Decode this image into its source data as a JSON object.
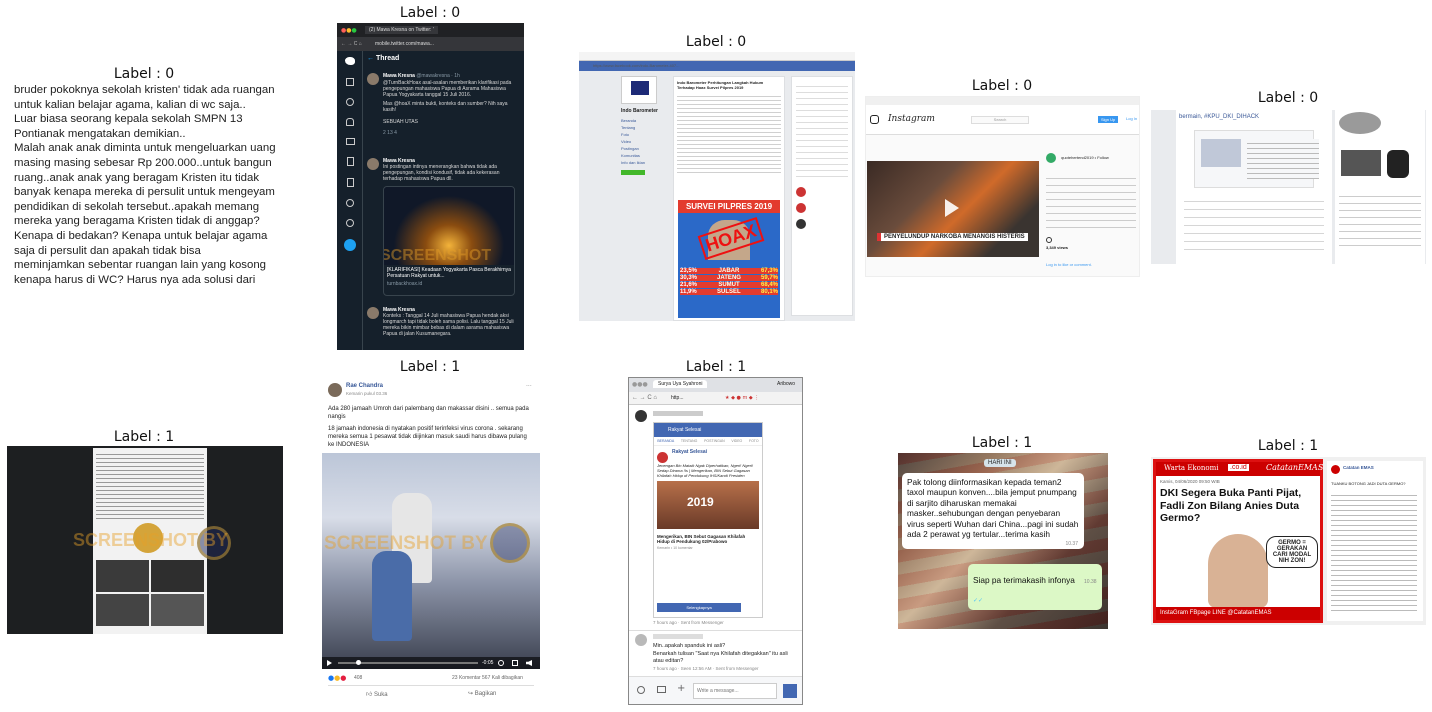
{
  "labels": [
    "Label : 0",
    "Label : 0",
    "Label : 0",
    "Label : 0",
    "Label : 0",
    "Label : 1",
    "Label : 1",
    "Label : 1",
    "Label : 1",
    "Label : 1"
  ],
  "text_post": {
    "lines": [
      "bruder pokoknya sekolah kristen'  tidak ada ruangan",
      "untuk kalian belajar agama, kalian di wc saja..",
      "Luar biasa seorang kepala sekolah SMPN 13",
      "Pontianak mengatakan demikian..",
      "Malah anak anak diminta untuk mengeluarkan uang",
      "masing masing sebesar Rp 200.000..untuk bangun",
      "ruang..anak anak yang beragam Kristen itu tidak",
      "banyak kenapa mereka di persulit untuk mengeyam",
      "pendidikan di sekolah tersebut..apakah memang",
      "mereka yang beragama Kristen tidak di anggap?",
      "Kenapa di bedakan? Kenapa untuk belajar agama",
      "saja di persulit dan apakah tidak bisa",
      "meminjamkan sebentar ruangan lain yang kosong",
      "kenapa harus di WC? Harus nya ada solusi dari"
    ]
  },
  "twitter": {
    "tab_title": "(2) Mawa Kresna on Twitter: '",
    "url": "mobile.twitter.com/mawa...",
    "header": "Thread",
    "user1": "Mawa Kresna",
    "handle1": "@mawakresna · 1h",
    "tweet1": "@TurnBackHoax asal-asalan memberikan klarifikasi pada pengepungan mahasiswa Papua di Asrama Mahasiswa Papua Yogyakarta tanggal 15 Juli 2016.",
    "tweet1b": "Mas @hoaX minta bukti, konteks dan sumber? Nih saya kasih!",
    "sebuah": "SEBUAH UTAS",
    "counts1": "2     13     4",
    "tweet2": "Ini postingan intinya menerangkan bahwa tidak ada pengepungan, kondisi kondusif, tidak ada kekerasan terhadap mahasiswa Papua dll.",
    "card_title": "[KLARIFIKASI] Keadaan Yogyakarta Pasca Berakhirnya Persatuan Rakyat untuk...",
    "card_url": "turnbackhoax.id",
    "tweet3": "Konteks : Tanggal 14 Juli mahasiswa Papua hendak aksi longmarch tapi tidak boleh sama polisi. Lalu tanggal 15 Juli mereka bikin mimbar bebas di dalam asrama mahasiswa Papua di jalan Kusumanegara.",
    "watermark": "SCREENSHOT"
  },
  "facebook1": {
    "url": "https://www.facebook.com/indo-Barometer-407...",
    "page_name": "Indo Barometer",
    "nav": [
      "Beranda",
      "Tentang",
      "Foto",
      "Video",
      "Postingan",
      "Komunitas",
      "Info dan Iklan"
    ],
    "post_text": "Indo Barometer Perhitungan Langkah Hukum Terhadap Hoax Survei Pilpres 2019",
    "banner": "SURVEI PILPRES 2019",
    "stamp": "HOAX",
    "left_pct": [
      "23,5%",
      "30,3%",
      "21,6%",
      "11,9%"
    ],
    "left_region": [
      "JABAR",
      "JATENG",
      "SUMUT",
      "SULSEL"
    ],
    "right_pct": [
      "67,3%",
      "59,7%",
      "68,4%",
      "80,1%"
    ]
  },
  "instagram": {
    "url": "www.instagram.com/p/...",
    "logo": "Instagram",
    "search": "Search",
    "signup": "Sign Up",
    "login": "Log In",
    "username": "quotehertend2019 • Follow",
    "caption": "PENYELUNDUP NARKOBA MENANGIS HISTERIS",
    "views": "3,349 views",
    "comment": "Log in to like or comment."
  },
  "dki_post": {
    "snippet": "bermain, #KPU_DKI_DIHACK",
    "handle": "@KPU_DKI_DIHACK"
  },
  "fb_dark": {
    "watermark": "SCREENSHOT BY"
  },
  "rae": {
    "name": "Rae Chandra",
    "time": "Kemarin pukul 03.36",
    "text1": "Ada 280 jamaah Umroh dari palembang dan makassar disini .. semua pada nangis",
    "text2": "18 jamaah indonesia di nyatakan positif terinfeksi virus corona . sekarang mereka semua 1 pesawat tidak diijinkan masuk saudi harus dibawa pulang ke INDONESIA",
    "watermark": "SCREENSHOT BY",
    "time_left": "-0:05",
    "reactions": "408",
    "comments": "23 Komentar  567 Kali dibagikan",
    "like": "Suka",
    "share": "Bagikan"
  },
  "messenger": {
    "tab": "Surya Uya Syahroni",
    "user": "Aribowo",
    "url": "http...",
    "page": "Rakyat Selesai",
    "tabs": [
      "BERANDA",
      "TENTANG",
      "POSTINGAN",
      "VIDEO",
      "FOTO"
    ],
    "post_title": "Jenengan Bin Mataik Ngak Diperhatikan, Ngeri! Ngeri! Sedap Dirama !Is | Mengerikan, BIN Sebut Gagasan Khilafah Hidup di Pendukung IHS/Kandi Presiden",
    "banner_year": "2019",
    "link_title": "Mengerikan, BIN Sebut Gagasan Khilafah Hidup di Pendukung 02/Prabowo",
    "link_meta": "Kemarin • 10 komentar",
    "btn": "Selengkapnya",
    "sent1": "7 hours ago · Sent from Messenger",
    "msg1": "Min..apakah spanduk ini asli?",
    "msg2": "Benarkah tulisan \"Saat nya Khilafah ditegakkan\" itu asli atau editan?",
    "sent2": "7 hours ago · Seen 12:56 AM · Sent from Messenger",
    "placeholder": "Write a message..."
  },
  "whatsapp": {
    "bubble1": "Pak tolong diinformasikan kepada teman2 taxol maupun konven....bila jemput pnumpang di sarjito diharuskan memakai masker..sehubungan dengan penyebaran virus seperti Wuhan dari China...pagi ini sudah ada 2 perawat yg tertular...terima kasih",
    "time1": "10.37",
    "bubble2": "Siap pa terimakasih infonya",
    "time2": "10.38",
    "hari_ini": "HARI INI"
  },
  "warta": {
    "site": "Warta Ekonomi",
    "domain": ".co.id",
    "brand": "CatatanEMAS",
    "date": "Kamis, 04/06/2020 09:50 WIB",
    "headline": "DKI Segera Buka Panti Pijat, Fadli Zon Bilang Anies Duta Germo?",
    "bubble": "GERMO = GERAKAN CARI MODAL NIH ZON!",
    "footer": "InstaGram FBpage LINE @CatatanEMAS",
    "side_name": "Catatan EMAS",
    "side_title": "TUANKU BOTONG JADI DUTA GERMO?"
  }
}
